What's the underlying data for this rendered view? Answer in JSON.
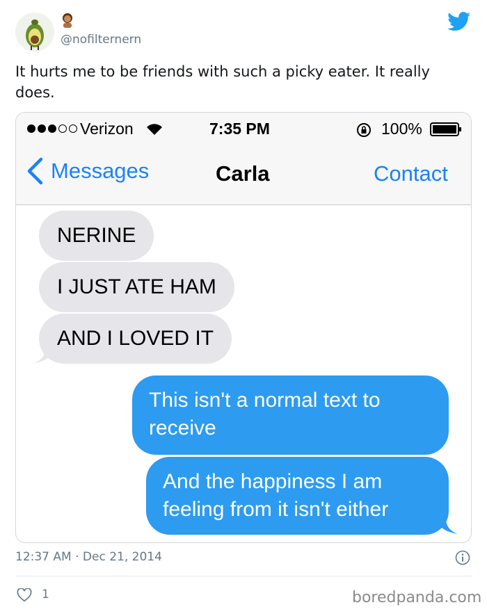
{
  "tweet": {
    "handle": "@nofilternern",
    "text": "It hurts me to be friends with such a picky eater. It really does.",
    "timestamp": "12:37 AM · Dec 21, 2014",
    "likes": "1",
    "avatar_icon": "avocado-avatar-icon",
    "handle_emoji": "woman-emoji-icon"
  },
  "screenshot": {
    "status_bar": {
      "carrier": "Verizon",
      "time": "7:35 PM",
      "battery": "100%",
      "signal_dots_filled": 3,
      "signal_dots_total": 5
    },
    "nav": {
      "back_label": "Messages",
      "title": "Carla",
      "right_label": "Contact"
    },
    "messages": [
      {
        "side": "received",
        "text": "NERINE"
      },
      {
        "side": "received",
        "text": "I JUST ATE HAM"
      },
      {
        "side": "received",
        "text": "AND I LOVED IT"
      },
      {
        "side": "sent",
        "text": "This isn't a normal text to receive"
      },
      {
        "side": "sent",
        "text": "And the happiness I am feeling from it isn't either"
      }
    ]
  },
  "watermark": "boredpanda.com",
  "colors": {
    "ios_blue": "#1a82f7",
    "sent_bubble": "#2d9bf0",
    "received_bubble": "#e5e5ea",
    "twitter_blue": "#1da1f2"
  }
}
